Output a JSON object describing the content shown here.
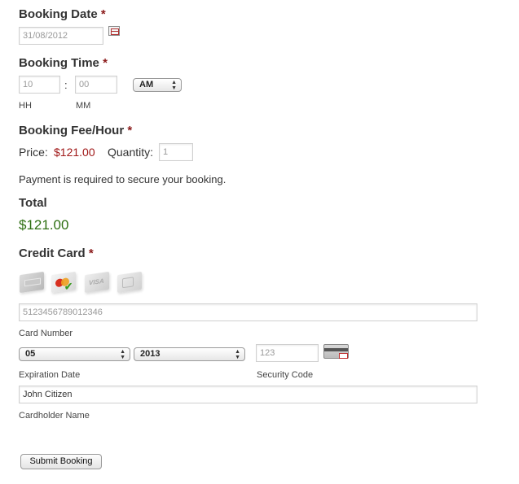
{
  "booking_date": {
    "label": "Booking Date",
    "required_mark": "*",
    "value": "31/08/2012",
    "calendar_icon": "calendar-icon"
  },
  "booking_time": {
    "label": "Booking Time",
    "required_mark": "*",
    "hour_value": "10",
    "minute_value": "00",
    "separator": ":",
    "ampm_selected": "AM",
    "hour_caption": "HH",
    "minute_caption": "MM"
  },
  "fee": {
    "label": "Booking Fee/Hour",
    "required_mark": "*",
    "price_label": "Price:",
    "price_value": "$121.00",
    "quantity_label": "Quantity:",
    "quantity_value": "1"
  },
  "payment_note": "Payment is required to secure your booking.",
  "total": {
    "label": "Total",
    "value": "$121.00"
  },
  "credit_card": {
    "label": "Credit Card",
    "required_mark": "*",
    "card_icons": [
      "amex-card-icon",
      "mastercard-card-icon",
      "visa-card-icon",
      "discover-card-icon"
    ],
    "card_number_value": "5123456789012346",
    "card_number_caption": "Card Number",
    "exp_month_selected": "05",
    "exp_year_selected": "2013",
    "expiration_caption": "Expiration Date",
    "security_code_value": "123",
    "security_code_caption": "Security Code",
    "security_code_icon": "card-back-cvv-icon",
    "cardholder_value": "John Citizen",
    "cardholder_caption": "Cardholder Name"
  },
  "submit_label": "Submit Booking",
  "colors": {
    "required": "#8b1a1a",
    "price": "#a01818",
    "total": "#2e6f12",
    "text": "#333333"
  }
}
